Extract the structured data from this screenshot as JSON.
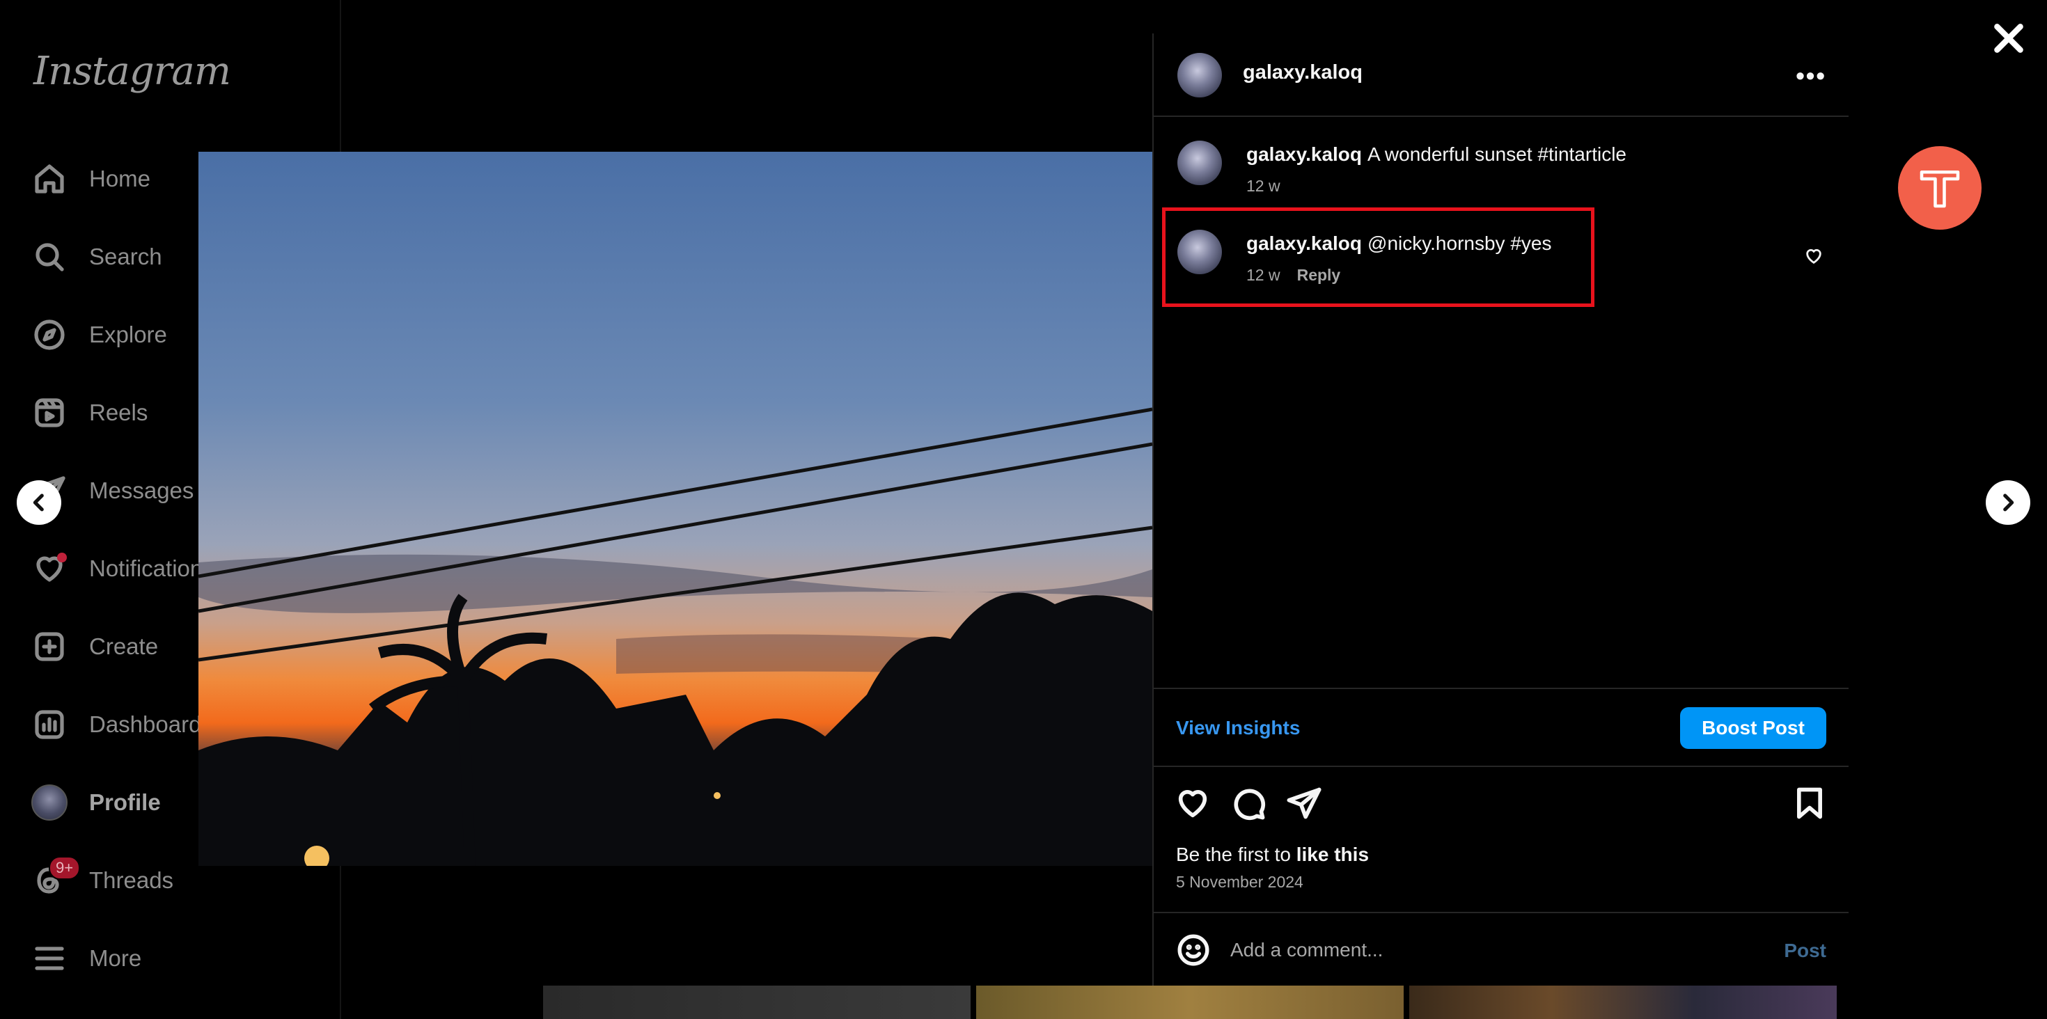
{
  "app": {
    "logo_text": "Instagram"
  },
  "sidebar": {
    "items": [
      {
        "label": "Home",
        "icon": "home-icon"
      },
      {
        "label": "Search",
        "icon": "search-icon"
      },
      {
        "label": "Explore",
        "icon": "compass-icon"
      },
      {
        "label": "Reels",
        "icon": "reels-icon"
      },
      {
        "label": "Messages",
        "icon": "messages-icon"
      },
      {
        "label": "Notifications",
        "icon": "heart-icon"
      },
      {
        "label": "Create",
        "icon": "plus-square-icon"
      },
      {
        "label": "Dashboard",
        "icon": "dashboard-icon"
      },
      {
        "label": "Profile",
        "icon": "avatar"
      },
      {
        "label": "Threads",
        "icon": "threads-icon",
        "badge": "9+"
      },
      {
        "label": "More",
        "icon": "menu-icon"
      }
    ]
  },
  "post": {
    "username": "galaxy.kaloq",
    "caption": {
      "username": "galaxy.kaloq",
      "text": "A wonderful sunset #tintarticle",
      "time": "12 w"
    },
    "comments": [
      {
        "username": "galaxy.kaloq",
        "text": "@nicky.hornsby #yes",
        "time": "12 w",
        "reply_label": "Reply"
      }
    ],
    "insights_label": "View Insights",
    "boost_label": "Boost Post",
    "likes_prefix": "Be the first to",
    "likes_action": "like this",
    "date": "5 November 2024",
    "comment_placeholder": "Add a comment...",
    "post_label": "Post"
  },
  "colors": {
    "accent": "#0095f6",
    "link": "#3897f0",
    "highlight": "#e8121c",
    "extension": "#f2604a"
  }
}
